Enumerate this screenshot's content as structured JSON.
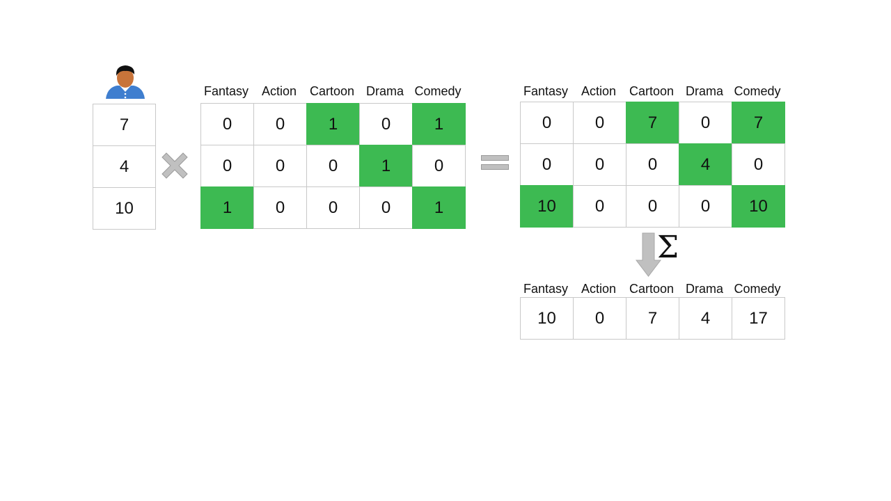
{
  "user_icon": "person-icon",
  "operators": {
    "multiply": "multiply-icon",
    "equals": "equals-icon",
    "sum_arrow": "arrow-down-icon",
    "sum_symbol": "Σ"
  },
  "colors": {
    "highlight": "#3dba52",
    "grid_border": "#c8c8c8",
    "operator_gray": "#c0c0c0"
  },
  "user_vector": [
    "7",
    "4",
    "10"
  ],
  "genres": [
    "Fantasy",
    "Action",
    "Cartoon",
    "Drama",
    "Comedy"
  ],
  "item_matrix": [
    [
      "0",
      "0",
      "1",
      "0",
      "1"
    ],
    [
      "0",
      "0",
      "0",
      "1",
      "0"
    ],
    [
      "1",
      "0",
      "0",
      "0",
      "1"
    ]
  ],
  "item_matrix_highlight": [
    [
      false,
      false,
      true,
      false,
      true
    ],
    [
      false,
      false,
      false,
      true,
      false
    ],
    [
      true,
      false,
      false,
      false,
      true
    ]
  ],
  "weighted_matrix": [
    [
      "0",
      "0",
      "7",
      "0",
      "7"
    ],
    [
      "0",
      "0",
      "0",
      "4",
      "0"
    ],
    [
      "10",
      "0",
      "0",
      "0",
      "10"
    ]
  ],
  "weighted_matrix_highlight": [
    [
      false,
      false,
      true,
      false,
      true
    ],
    [
      false,
      false,
      false,
      true,
      false
    ],
    [
      true,
      false,
      false,
      false,
      true
    ]
  ],
  "sum_row": [
    "10",
    "0",
    "7",
    "4",
    "17"
  ]
}
